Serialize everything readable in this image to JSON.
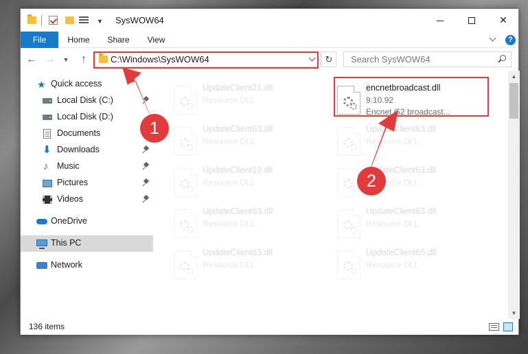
{
  "window": {
    "title": "SysWOW64"
  },
  "ribbon": {
    "tabs": [
      "File",
      "Home",
      "Share",
      "View"
    ]
  },
  "address": {
    "path": "C:\\Windows\\SysWOW64"
  },
  "search": {
    "placeholder": "Search SysWOW64"
  },
  "sidebar": {
    "items": [
      {
        "label": "Quick access",
        "icon": "star-icon",
        "pinned": false
      },
      {
        "label": "Local Disk (C:)",
        "icon": "disk-icon",
        "pinned": true
      },
      {
        "label": "Local Disk (D:)",
        "icon": "disk-icon",
        "pinned": false
      },
      {
        "label": "Documents",
        "icon": "documents-icon",
        "pinned": false
      },
      {
        "label": "Downloads",
        "icon": "download-icon",
        "pinned": true
      },
      {
        "label": "Music",
        "icon": "music-icon",
        "pinned": true
      },
      {
        "label": "Pictures",
        "icon": "pictures-icon",
        "pinned": true
      },
      {
        "label": "Videos",
        "icon": "videos-icon",
        "pinned": true
      },
      {
        "label": "OneDrive",
        "icon": "cloud-icon",
        "pinned": false
      },
      {
        "label": "This PC",
        "icon": "computer-icon",
        "pinned": false,
        "selected": true
      },
      {
        "label": "Network",
        "icon": "network-icon",
        "pinned": false
      }
    ]
  },
  "files": [
    {
      "name": "UpdateClient21.dll",
      "line1": "Resource DLL",
      "line2": "",
      "faded": true
    },
    {
      "name": "encnetbroadcast.dll",
      "line1": "9.10.92",
      "line2": "Encnet G2 broadcast...",
      "faded": false
    },
    {
      "name": "UpdateClient63.dll",
      "line1": "Resource DLL",
      "line2": "",
      "faded": true
    },
    {
      "name": "UpdateClient63.dll",
      "line1": "Resource DLL",
      "line2": "",
      "faded": true
    },
    {
      "name": "UpdateClient19.dll",
      "line1": "Resource DLL",
      "line2": "",
      "faded": true
    },
    {
      "name": "UpdateClient63.dll",
      "line1": "Resource DLL",
      "line2": "",
      "faded": true
    },
    {
      "name": "UpdateClient63.dll",
      "line1": "Resource DLL",
      "line2": "",
      "faded": true
    },
    {
      "name": "UpdateClient63.dll",
      "line1": "Resource DLL",
      "line2": "",
      "faded": true
    },
    {
      "name": "UpdateClient63.dll",
      "line1": "Resource DLL",
      "line2": "",
      "faded": true
    },
    {
      "name": "UpdateClient65.dll",
      "line1": "Resource DLL",
      "line2": "",
      "faded": true
    }
  ],
  "status": {
    "item_count": "136 items"
  },
  "annotations": {
    "step1": "1",
    "step2": "2",
    "color": "#e23b3b"
  },
  "colors": {
    "accent": "#1979ca",
    "highlight": "#e23b3b"
  }
}
